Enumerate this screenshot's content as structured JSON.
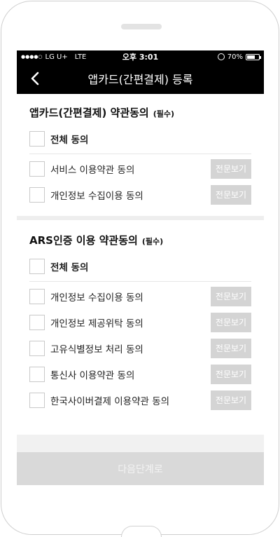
{
  "status_bar": {
    "carrier": "LG U+",
    "network": "LTE",
    "time": "오후 3:01",
    "battery": "70%",
    "battery_level": 0.7
  },
  "header": {
    "title": "앱카드(간편결제) 등록"
  },
  "appcard_section": {
    "title": "앱카드(간편결제) 약관동의",
    "required": "(필수)",
    "all_agree": "전체 동의",
    "items": [
      {
        "label": "서비스 이용약관 동의",
        "view": "전문보기"
      },
      {
        "label": "개인정보 수집이용 동의",
        "view": "전문보기"
      }
    ]
  },
  "ars_section": {
    "title": "ARS인증 이용 약관동의",
    "required": "(필수)",
    "all_agree": "전체 동의",
    "items": [
      {
        "label": "개인정보 수집이용 동의",
        "view": "전문보기"
      },
      {
        "label": "개인정보 제공위탁 동의",
        "view": "전문보기"
      },
      {
        "label": "고유식별정보 처리 동의",
        "view": "전문보기"
      },
      {
        "label": "통신사 이용약관 동의",
        "view": "전문보기"
      },
      {
        "label": "한국사이버결제 이용약관 동의",
        "view": "전문보기"
      }
    ]
  },
  "footer": {
    "next_label": "다음단계로"
  }
}
